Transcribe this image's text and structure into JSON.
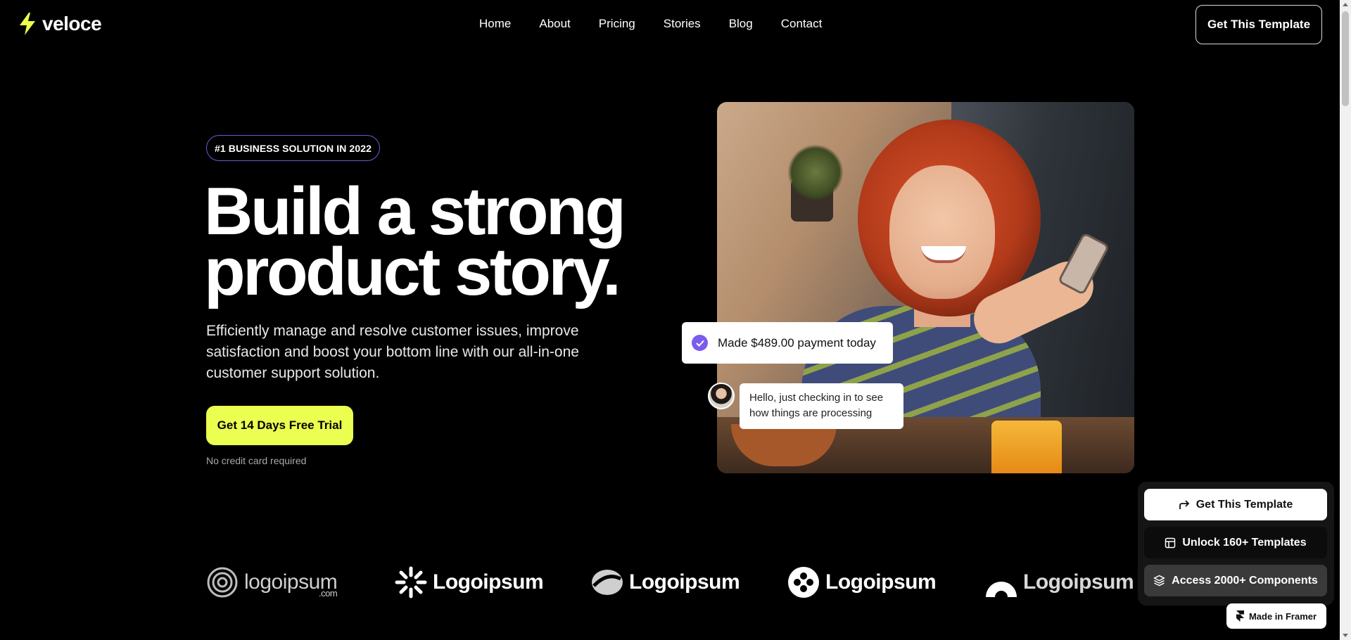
{
  "nav": {
    "brand": "veloce",
    "links": [
      "Home",
      "About",
      "Pricing",
      "Stories",
      "Blog",
      "Contact"
    ],
    "cta_label": "Get This Template"
  },
  "hero": {
    "badge": "#1 BUSINESS SOLUTION IN 2022",
    "headline_line1": "Build a strong",
    "headline_line2": "product story.",
    "subtext": "Efficiently manage and resolve customer issues, improve satisfaction and boost your bottom line with our all-in-one customer support solution.",
    "cta_label": "Get 14 Days Free Trial",
    "note": "No credit card required"
  },
  "cards": {
    "payment_text": "Made $489.00 payment today",
    "chat_text": "Hello, just checking in to see how things are processing"
  },
  "logos": [
    "logoipsum",
    "Logoipsum",
    "Logoipsum",
    "Logoipsum",
    "Logoipsum"
  ],
  "logo_suffix": ".com",
  "framer": {
    "get_template": "Get This Template",
    "unlock_templates": "Unlock 160+ Templates",
    "access_components": "Access 2000+ Components",
    "made_in": "Made in Framer"
  },
  "colors": {
    "accent_yellow": "#eaff4f",
    "badge_border": "#6e5ad6",
    "check_purple": "#7b5bf0"
  }
}
